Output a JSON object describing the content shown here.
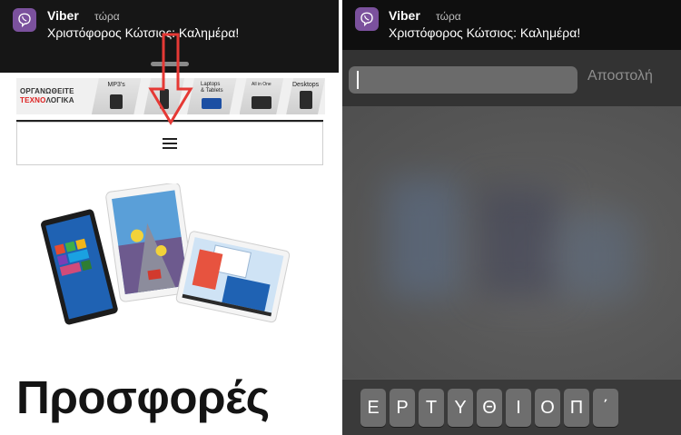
{
  "left": {
    "notification": {
      "app_name": "Viber",
      "time": "τώρα",
      "message": "Χριστόφορος Κώτσιος: Καλημέρα!"
    },
    "banner": {
      "brand_line1": "ΟΡΓΑΝΩΘΕΙΤΕ",
      "brand_line2a": "ΤΕΧΝΟ",
      "brand_line2b": "ΛΟΓΙΚΑ",
      "segments": [
        "MP3's",
        "",
        "Laptops\n& Tablets",
        "All in One",
        "Desktops"
      ]
    },
    "headline": "Προσφορές"
  },
  "right": {
    "notification": {
      "app_name": "Viber",
      "time": "τώρα",
      "message": "Χριστόφορος Κώτσιος: Καλημέρα!"
    },
    "reply": {
      "input_value": "",
      "send_label": "Αποστολή"
    },
    "keyboard": {
      "keys": [
        "Ε",
        "Ρ",
        "Τ",
        "Υ",
        "Θ",
        "Ι",
        "Ο",
        "Π",
        "΄"
      ]
    }
  },
  "colors": {
    "viber": "#7b519d",
    "arrow": "#e53935",
    "notification_bg": "#161616"
  }
}
